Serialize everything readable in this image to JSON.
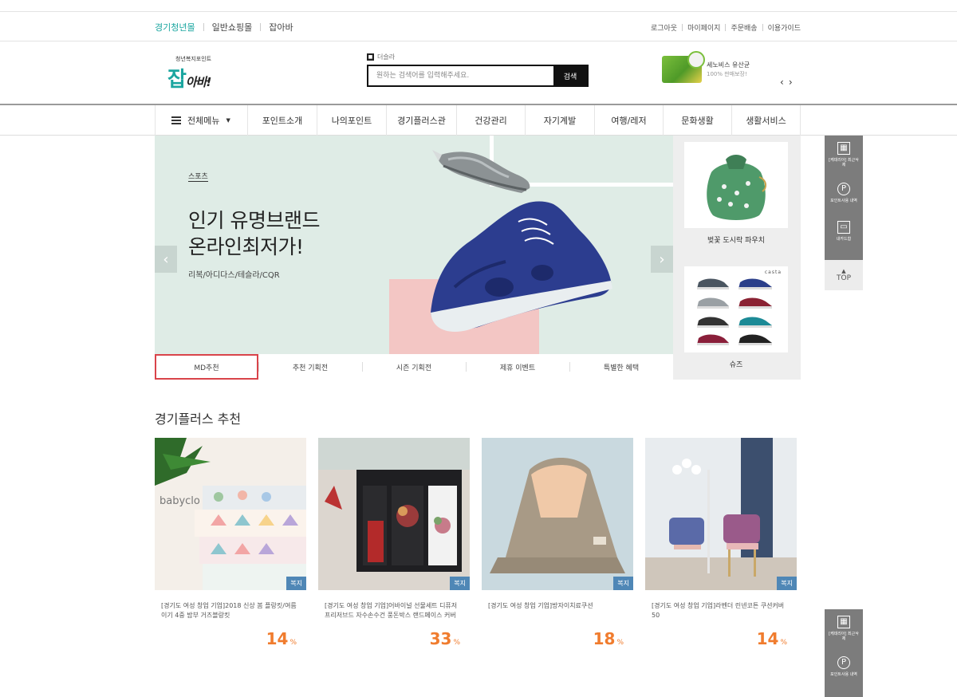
{
  "topbar": {
    "mall_links": [
      "경기청년몰",
      "일반쇼핑몰",
      "잡아바"
    ],
    "util_links": [
      "로그아웃",
      "마이페이지",
      "주문배송",
      "이용가이드"
    ]
  },
  "header": {
    "logo_sub": "청년복지포인트",
    "logo_main": "잡",
    "logo_tail": "아바!",
    "search_tag": "더슬라",
    "search_placeholder": "원하는 검색어를 입력해주세요.",
    "search_button": "검색",
    "promo_title": "세노비스 유산균",
    "promo_desc": "100% 판매보장!",
    "promo_prev": "‹",
    "promo_next": "›"
  },
  "nav": {
    "all_menu": "전체메뉴",
    "items": [
      "포인트소개",
      "나의포인트",
      "경기플러스관",
      "건강관리",
      "자기계발",
      "여행/레저",
      "문화생활",
      "생활서비스"
    ]
  },
  "hero": {
    "tag": "스포츠",
    "title_line1": "인기 유명브랜드",
    "title_line2": "온라인최저가!",
    "subtitle": "리복/아디다스/테슬라/CQR",
    "prev": "‹",
    "next": "›",
    "tabs": [
      "MD추천",
      "추천 기획전",
      "시즌 기획전",
      "제휴 이벤트",
      "특별한 혜택"
    ]
  },
  "side_products": [
    {
      "name": "벚꽃 도시락 파우치"
    },
    {
      "name": "슈즈",
      "brand_text": "casta"
    }
  ],
  "section": {
    "title": "경기플러스 추천",
    "products": [
      {
        "brand": "babyclo",
        "badge": "복지",
        "name": "[경기도 여성 창업 기업]2018 신상 봄 플랑킷/여름이기 4중 밤부 거즈블랑킷",
        "discount": "14",
        "unit": "%"
      },
      {
        "badge": "복지",
        "name": "[경기도 여성 창업 기업]어바이널 선물세트 디퓨저 프리저브드 자수손수건 풍돈박스 랜드페이스 커버",
        "discount": "33",
        "unit": "%"
      },
      {
        "badge": "복지",
        "name": "[경기도 여성 창업 기업]방자이치료쿠션",
        "discount": "18",
        "unit": "%"
      },
      {
        "badge": "복지",
        "name": "[경기도 여성 창업 기업]라벤더 린넨코튼 쿠션커버50",
        "discount": "14",
        "unit": "%"
      }
    ]
  },
  "quickbar": {
    "item1": "[케데리아] 최근삭제",
    "item2": "포인트사용 내역",
    "item3": "내카드함",
    "top": "TOP",
    "item4": "[케데리아] 최근삭제",
    "item5": "포인트사용 내역"
  },
  "colors": {
    "accent": "#1ba6a0",
    "discount": "#f07c2e",
    "badge": "#4f87b6",
    "active_tab_border": "#d9444a"
  }
}
